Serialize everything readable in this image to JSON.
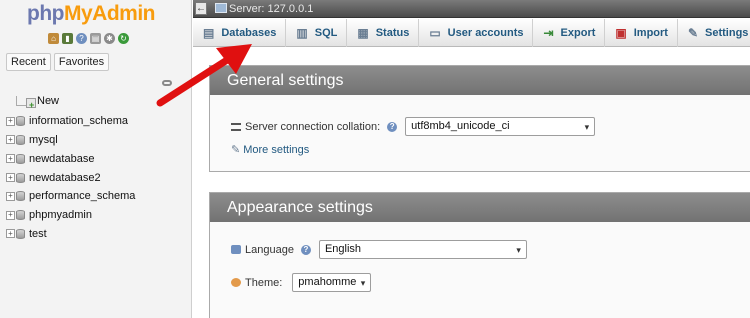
{
  "nav": {
    "logo": {
      "php": "php",
      "my": "My",
      "admin": "Admin"
    },
    "tabs": [
      "Recent",
      "Favorites"
    ],
    "tree": [
      {
        "label": "New",
        "type": "new"
      },
      {
        "label": "information_schema",
        "type": "db"
      },
      {
        "label": "mysql",
        "type": "db"
      },
      {
        "label": "newdatabase",
        "type": "db"
      },
      {
        "label": "newdatabase2",
        "type": "db"
      },
      {
        "label": "performance_schema",
        "type": "db"
      },
      {
        "label": "phpmyadmin",
        "type": "db"
      },
      {
        "label": "test",
        "type": "db"
      }
    ]
  },
  "serverbar": {
    "text": "Server: 127.0.0.1"
  },
  "menu": {
    "databases": "Databases",
    "sql": "SQL",
    "status": "Status",
    "user_accounts": "User accounts",
    "export": "Export",
    "import": "Import",
    "settings": "Settings"
  },
  "general": {
    "title": "General settings",
    "collation_label": "Server connection collation:",
    "collation_value": "utf8mb4_unicode_ci",
    "more_settings": "More settings"
  },
  "appearance": {
    "title": "Appearance settings",
    "language_label": "Language",
    "language_value": "English",
    "theme_label": "Theme:",
    "theme_value": "pmahomme"
  },
  "colors": {
    "accent_link": "#235a81",
    "logo_orange": "#f89c0e",
    "logo_blue": "#6c78af",
    "arrow_red": "#e01010"
  }
}
